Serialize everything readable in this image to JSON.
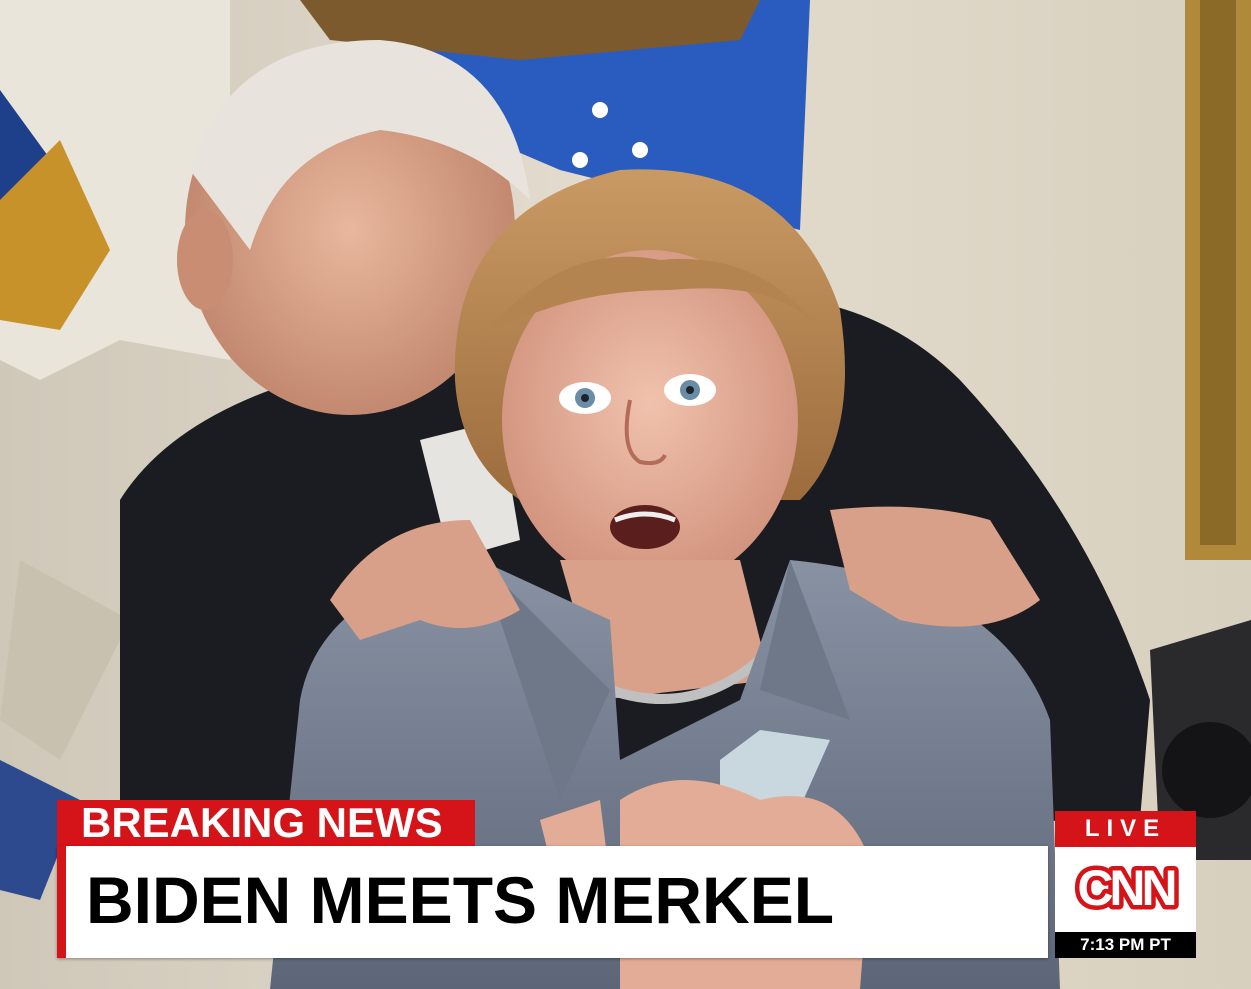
{
  "chyron": {
    "tag": "BREAKING NEWS",
    "headline": "BIDEN MEETS MERKEL",
    "live": "LIVE",
    "logo": "CNN",
    "time": "7:13 PM PT"
  },
  "colors": {
    "brand_red": "#d5141a",
    "chyron_white": "#ffffff",
    "time_bg": "#000000"
  }
}
